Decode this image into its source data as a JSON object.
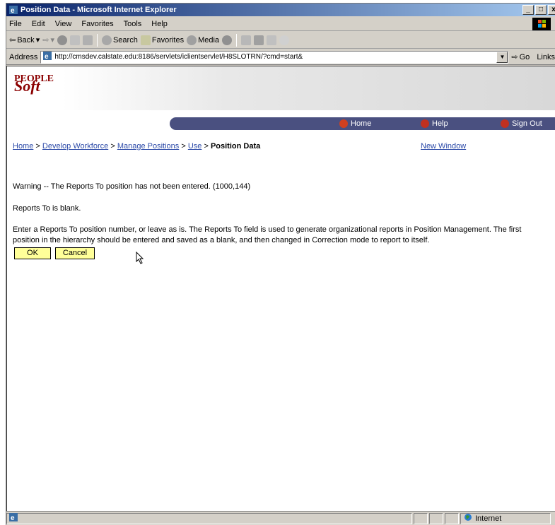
{
  "window": {
    "title": "Position Data - Microsoft Internet Explorer"
  },
  "menu": [
    "File",
    "Edit",
    "View",
    "Favorites",
    "Tools",
    "Help"
  ],
  "toolbar": {
    "back": "Back",
    "search": "Search",
    "favorites": "Favorites",
    "media": "Media"
  },
  "address": {
    "label": "Address",
    "url": "http://cmsdev.calstate.edu:8186/servlets/iclientservlet/H8SLOTRN/?cmd=start&",
    "go": "Go",
    "links": "Links"
  },
  "header": {
    "logo_top": "PEOPLE",
    "logo_bottom": "Soft",
    "home": "Home",
    "help": "Help",
    "signout": "Sign Out"
  },
  "breadcrumb": {
    "home": "Home",
    "develop": "Develop Workforce",
    "manage": "Manage Positions",
    "use": "Use",
    "current": "Position Data",
    "sep": ">"
  },
  "new_window": "New Window",
  "message": {
    "warning": "Warning -- The Reports To position has not been entered. (1000,144)",
    "blank": "Reports To is blank.",
    "detail_line1": "Enter a Reports To position number, or leave as is. The Reports To field is used to generate organizational reports in Position Management. The first",
    "detail_line2": "position in the hierarchy should be entered and saved as a blank, and then changed in Correction mode to report to itself."
  },
  "buttons": {
    "ok": "OK",
    "cancel": "Cancel"
  },
  "status": {
    "zone": "Internet"
  }
}
